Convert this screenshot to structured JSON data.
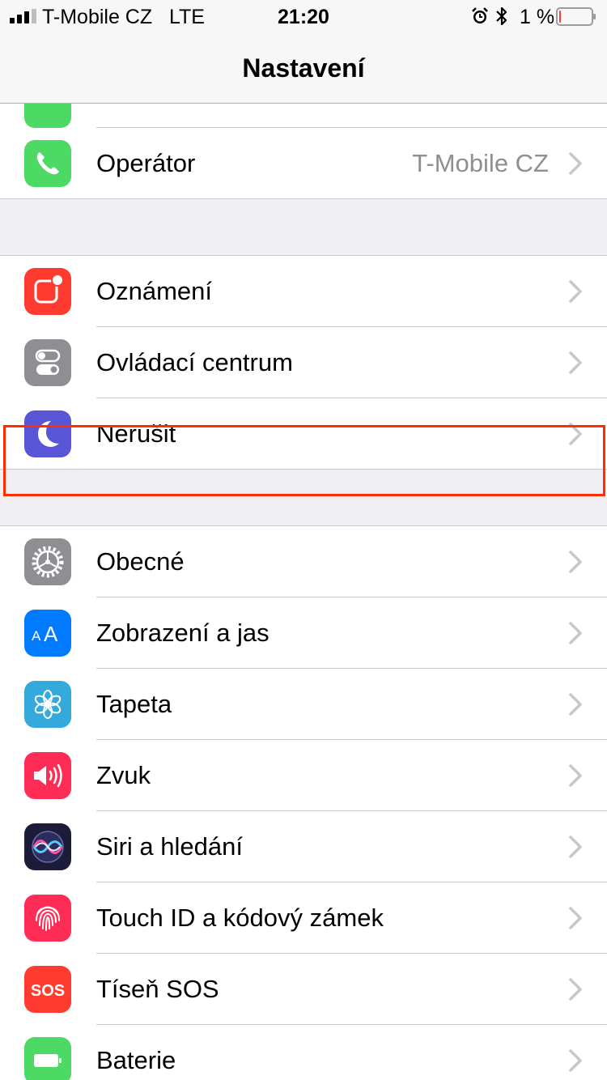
{
  "status_bar": {
    "carrier": "T-Mobile CZ   LTE",
    "time": "21:20",
    "battery_percent": "1 %",
    "battery_level": 0.01,
    "signal_bars": 3
  },
  "nav": {
    "title": "Nastavení"
  },
  "groups": [
    {
      "rows": [
        {
          "label": "Operátor",
          "value": "T-Mobile CZ",
          "icon": "phone-icon",
          "icon_color": "#4cd964"
        }
      ]
    },
    {
      "rows": [
        {
          "label": "Oznámení",
          "icon": "notifications-icon",
          "icon_color": "#ff3b30"
        },
        {
          "label": "Ovládací centrum",
          "icon": "control-center-icon",
          "icon_color": "#8e8e93"
        },
        {
          "label": "Nerušit",
          "icon": "moon-icon",
          "icon_color": "#5856d6"
        }
      ]
    },
    {
      "rows": [
        {
          "label": "Obecné",
          "icon": "gear-icon",
          "icon_color": "#8e8e93",
          "highlighted": true
        },
        {
          "label": "Zobrazení a jas",
          "icon": "text-size-icon",
          "icon_color": "#007aff"
        },
        {
          "label": "Tapeta",
          "icon": "flower-icon",
          "icon_color": "#34aadc"
        },
        {
          "label": "Zvuk",
          "icon": "speaker-icon",
          "icon_color": "#ff2d55"
        },
        {
          "label": "Siri a hledání",
          "icon": "siri-icon",
          "icon_color": "#1c1c3a"
        },
        {
          "label": "Touch ID a kódový zámek",
          "icon": "fingerprint-icon",
          "icon_color": "#ff2d55"
        },
        {
          "label": "Tíseň SOS",
          "icon": "sos-icon",
          "icon_color": "#ff3b30",
          "icon_text": "SOS"
        },
        {
          "label": "Baterie",
          "icon": "battery-icon",
          "icon_color": "#4cd964"
        }
      ]
    }
  ]
}
